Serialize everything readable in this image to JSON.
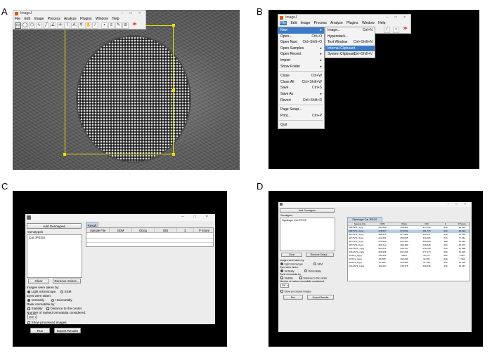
{
  "panel_labels": [
    "A",
    "B",
    "C",
    "D"
  ],
  "imagej": {
    "title": "ImageJ",
    "menus": [
      "File",
      "Edit",
      "Image",
      "Process",
      "Analyze",
      "Plugins",
      "Window",
      "Help"
    ],
    "window_controls": "–  □  ×",
    "extra_tools_glyph": "≫"
  },
  "file_menu": {
    "items": [
      {
        "label": "New",
        "shortcut": "",
        "submenu": true,
        "highlighted": true
      },
      {
        "label": "Open...",
        "shortcut": "Ctrl+O"
      },
      {
        "label": "Open Next",
        "shortcut": "Ctrl+Shift+O"
      },
      {
        "label": "Open Samples",
        "shortcut": "",
        "submenu": true
      },
      {
        "label": "Open Recent",
        "shortcut": "",
        "submenu": true
      },
      {
        "label": "Import",
        "shortcut": "",
        "submenu": true
      },
      {
        "label": "Show Folder",
        "shortcut": "",
        "submenu": true
      },
      {
        "sep": true
      },
      {
        "label": "Close",
        "shortcut": "Ctrl+W"
      },
      {
        "label": "Close All",
        "shortcut": "Ctrl+Shift+W"
      },
      {
        "label": "Save",
        "shortcut": "Ctrl+S"
      },
      {
        "label": "Save As",
        "shortcut": "",
        "submenu": true
      },
      {
        "label": "Revert",
        "shortcut": "Ctrl+Shift+R"
      },
      {
        "sep": true
      },
      {
        "label": "Page Setup...",
        "shortcut": ""
      },
      {
        "label": "Print...",
        "shortcut": "Ctrl+P"
      },
      {
        "sep": true
      },
      {
        "label": "Quit",
        "shortcut": ""
      }
    ],
    "new_submenu": [
      {
        "label": "Image...",
        "shortcut": "Ctrl+N"
      },
      {
        "label": "Hyperstack...",
        "shortcut": ""
      },
      {
        "label": "Text Window",
        "shortcut": "Ctrl+Shift+N"
      },
      {
        "label": "Internal Clipboard",
        "shortcut": "",
        "highlighted": true
      },
      {
        "label": "System Clipboard",
        "shortcut": "Ctrl+Shift+V"
      }
    ]
  },
  "ommatidia_plugin": {
    "window_controls": "–  □  ×",
    "add_genotypes": "Add Genotypes",
    "genotypes_header": "Genotypes",
    "genotype_entry": "Cat JPEGS",
    "clear": "Clear",
    "remove_select": "Remove Select...",
    "images_taken_by": "Images were taken by:",
    "light_microscope": "Light microscope",
    "sem": "SEM",
    "eyes_taken": "Eyes were taken:",
    "vertically": "Vertically",
    "horizontally": "Horizontally",
    "rank_by": "Rank ommatidia by:",
    "stability": "Stability",
    "distance_center": "Distance to the center",
    "number_ranked": "Number of ranked ommatidia considered:",
    "number_value": "200",
    "show_processed": "Show processed images",
    "run": "Run",
    "export": "Export Results",
    "result_tab_c": "Result",
    "result_tab_d": "Flyeshape Cat JPEGS",
    "columns": [
      "Sample File",
      "ODM",
      "ODσμ",
      "ODI",
      "Σ",
      "P Score"
    ]
  },
  "results_rows": [
    [
      "4097ST1_1.jpg",
      "244.299",
      "169.301",
      "374.792",
      "630",
      "98.644"
    ],
    [
      "4097ST1_2.jpg",
      "478.637",
      "670.091",
      "181.776",
      "634",
      "94.624"
    ],
    [
      "4477ST1_3.jpg",
      "192.473",
      "271.202",
      "123.171",
      "644",
      "97.640"
    ],
    [
      "4477ST1_4.jpg",
      "212.601",
      "256.065",
      "114.426",
      "616",
      "77.961"
    ],
    [
      "8177ST1_5.jpg",
      "370.640",
      "610.404",
      "383.683",
      "489",
      "61.661"
    ],
    [
      "4477ST1_6.jpg",
      "459.712",
      "390.469",
      "220.626",
      "594",
      "32.570"
    ],
    [
      "KOL4ST1_1.jpg",
      "294.271",
      "430.737",
      "278.762",
      "616",
      "27.658"
    ],
    [
      "KOL4ST1_2.jpg",
      "366.956",
      "602.296",
      "277.473",
      "626",
      "61.329"
    ],
    [
      "KOST1_3.jpg",
      "141.930",
      "190.8",
      "93.471",
      "592",
      "9.067"
    ],
    [
      "KOST1_4.jpg",
      "80.505",
      "190.249",
      "91.562",
      "640",
      "7.934"
    ],
    [
      "KOST1_5.jpg",
      "87.362",
      "220.980",
      "97.786",
      "612",
      "10.402"
    ],
    [
      "KOL4ST1_6.jpg",
      "162.407",
      "336.376",
      "200.435",
      "332",
      "61.467"
    ]
  ]
}
